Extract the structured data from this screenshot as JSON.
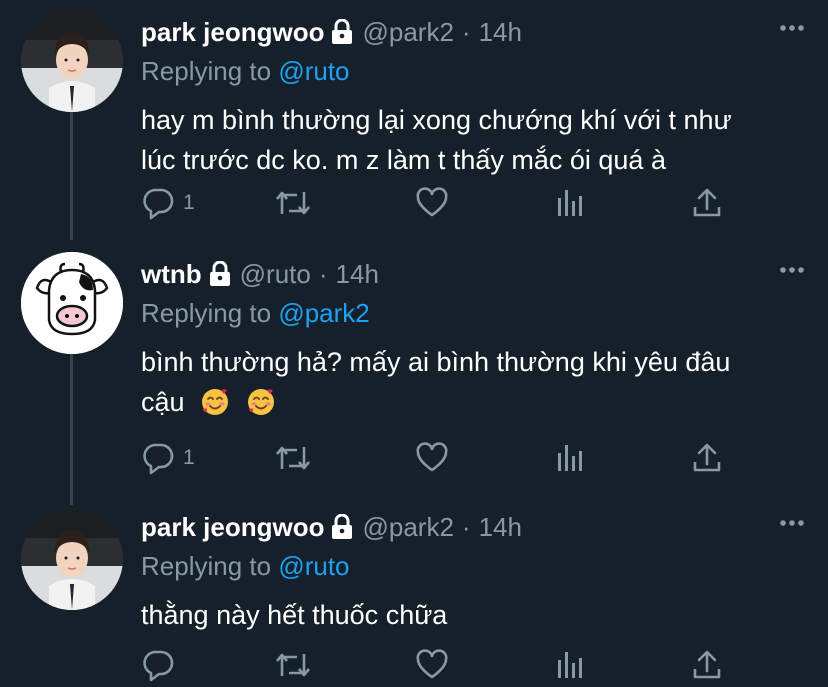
{
  "tweets": [
    {
      "name": "park jeongwoo",
      "handle": "@park2",
      "time": "14h",
      "reply_prefix": "Replying to",
      "reply_to": "@ruto",
      "text_line1": "hay m bình thường lại xong chướng khí với t như",
      "text_line2": "lúc trước dc ko. m z làm t thấy mắc ói quá à",
      "reply_count": "1"
    },
    {
      "name": "wtnb",
      "handle": "@ruto",
      "time": "14h",
      "reply_prefix": "Replying to",
      "reply_to": "@park2",
      "text_line1": "bình thường hả? mấy ai bình thường khi yêu đâu",
      "text_line2": "cậu",
      "reply_count": "1"
    },
    {
      "name": "park jeongwoo",
      "handle": "@park2",
      "time": "14h",
      "reply_prefix": "Replying to",
      "reply_to": "@ruto",
      "text_line1": "thằng này hết thuốc chữa",
      "reply_count": ""
    }
  ],
  "icons": [
    "lock-icon",
    "more-icon",
    "reply-icon",
    "retweet-icon",
    "like-icon",
    "analytics-icon",
    "share-icon",
    "smiling-hearts-emoji"
  ],
  "colors": {
    "background": "#15202b",
    "muted": "#8899a6",
    "mention": "#1da1f2",
    "divider": "#38444d"
  }
}
